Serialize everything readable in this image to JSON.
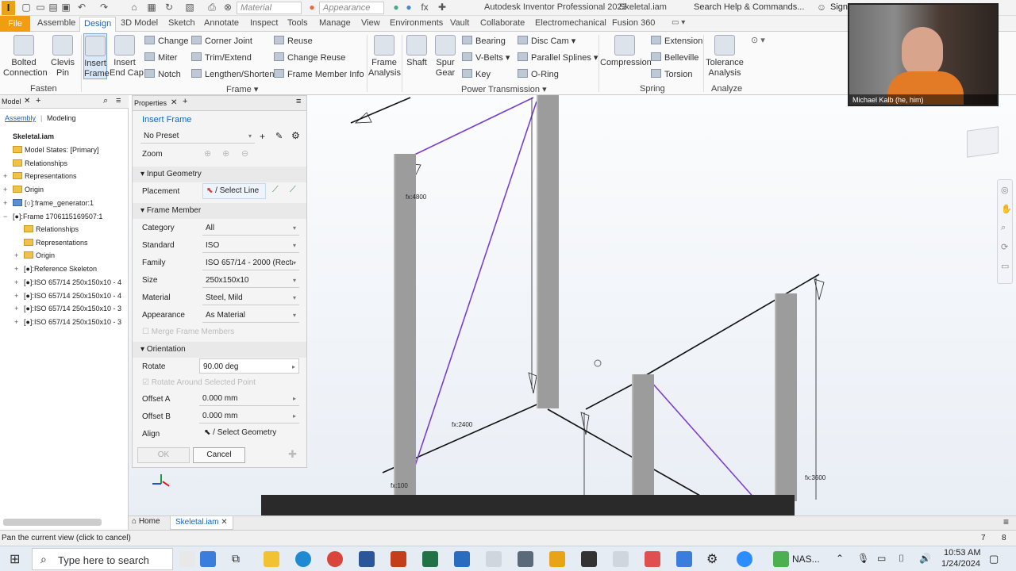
{
  "titlebar": {
    "material_combo": "Material",
    "appearance_combo": "Appearance",
    "app_title": "Autodesk Inventor Professional 2023",
    "doc_title": "Skeletal.iam",
    "search_placeholder": "Search Help & Commands...",
    "sign_in": "Sign"
  },
  "tabs": [
    "File",
    "Assemble",
    "Design",
    "3D Model",
    "Sketch",
    "Annotate",
    "Inspect",
    "Tools",
    "Manage",
    "View",
    "Environments",
    "Vault",
    "Collaborate",
    "Electromechanical",
    "Fusion 360"
  ],
  "active_tab": "Design",
  "ribbon": {
    "fasten": {
      "title": "Fasten",
      "bolted": "Bolted\nConnection",
      "clevis": "Clevis\nPin"
    },
    "frame": {
      "title": "Frame",
      "insert_frame": "Insert\nFrame",
      "insert_end_cap": "Insert\nEnd Cap",
      "change": "Change",
      "miter": "Miter",
      "notch": "Notch",
      "corner_joint": "Corner Joint",
      "trim_extend": "Trim/Extend",
      "lengthen_shorten": "Lengthen/Shorten",
      "reuse": "Reuse",
      "change_reuse": "Change Reuse",
      "frame_member_info": "Frame Member Info"
    },
    "power": {
      "title": "Power Transmission",
      "frame_analysis": "Frame\nAnalysis",
      "shaft": "Shaft",
      "spur_gear": "Spur\nGear",
      "bearing": "Bearing",
      "v_belts": "V-Belts",
      "key": "Key",
      "disc_cam": "Disc Cam",
      "parallel_splines": "Parallel Splines",
      "o_ring": "O-Ring"
    },
    "spring": {
      "title": "Spring",
      "compression": "Compression",
      "extension": "Extension",
      "belleville": "Belleville",
      "torsion": "Torsion"
    },
    "analyze": {
      "title": "Analyze",
      "tolerance": "Tolerance\nAnalysis"
    }
  },
  "browser": {
    "tab_model": "Model",
    "sub_assembly": "Assembly",
    "sub_modeling": "Modeling",
    "items": [
      "Skeletal.iam",
      "Model States: [Primary]",
      "Relationships",
      "Representations",
      "Origin",
      "[○]:frame_generator:1",
      "[●]:Frame 1706115169507:1",
      "Relationships",
      "Representations",
      "Origin",
      "[●]:Reference Skeleton",
      "[●]:ISO 657/14 250x150x10 - 4",
      "[●]:ISO 657/14 250x150x10 - 4",
      "[●]:ISO 657/14 250x150x10 - 3",
      "[●]:ISO 657/14 250x150x10 - 3"
    ]
  },
  "properties": {
    "tab": "Properties",
    "command": "Insert Frame",
    "preset": "No Preset",
    "zoom_label": "Zoom",
    "input_geometry": "Input Geometry",
    "placement_label": "Placement",
    "select_line": "Select Line",
    "frame_member": "Frame Member",
    "category_label": "Category",
    "category": "All",
    "standard_label": "Standard",
    "standard": "ISO",
    "family_label": "Family",
    "family": "ISO 657/14 - 2000 (Recta",
    "size_label": "Size",
    "size": "250x150x10",
    "material_label": "Material",
    "material": "Steel, Mild",
    "appearance_label": "Appearance",
    "appearance": "As Material",
    "merge": "Merge Frame Members",
    "orientation": "Orientation",
    "rotate_label": "Rotate",
    "rotate": "90.00 deg",
    "rotate_around": "Rotate Around Selected Point",
    "offset_a_label": "Offset A",
    "offset_a": "0.000 mm",
    "offset_b_label": "Offset B",
    "offset_b": "0.000 mm",
    "align_label": "Align",
    "select_geometry": "Select Geometry",
    "ok": "OK",
    "cancel": "Cancel"
  },
  "viewport": {
    "dims": [
      "fx:4800",
      "fx:2400",
      "fx:100",
      "fx:3600"
    ]
  },
  "doctabs": {
    "home": "Home",
    "doc": "Skeletal.iam"
  },
  "status": {
    "message": "Pan the current view (click to cancel)",
    "n1": "7",
    "n2": "8"
  },
  "taskbar": {
    "search": "Type here to search",
    "time": "10:53 AM",
    "date": "1/24/2024",
    "nas": "NAS..."
  },
  "webcam": {
    "name": "Michael Kalb (he, him)"
  },
  "colors": {
    "accent": "#1565c0",
    "file_tab": "#f39c12",
    "skeleton": "#7b3fd1"
  }
}
